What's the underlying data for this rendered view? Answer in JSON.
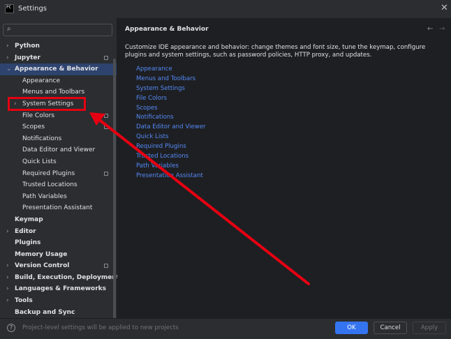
{
  "window": {
    "title": "Settings",
    "app_icon_text": "PC",
    "close_glyph": "✕"
  },
  "search": {
    "value": "",
    "placeholder": ""
  },
  "tree": [
    {
      "label": "Python",
      "level": 0,
      "bold": true,
      "chevron": "›",
      "proj": false
    },
    {
      "label": "Jupyter",
      "level": 0,
      "bold": true,
      "chevron": "›",
      "proj": true
    },
    {
      "label": "Appearance & Behavior",
      "level": 0,
      "bold": true,
      "chevron": "⌄",
      "proj": false,
      "selected": true
    },
    {
      "label": "Appearance",
      "level": 1,
      "bold": false,
      "chevron": "",
      "proj": false
    },
    {
      "label": "Menus and Toolbars",
      "level": 1,
      "bold": false,
      "chevron": "",
      "proj": false
    },
    {
      "label": "System Settings",
      "level": 1,
      "bold": false,
      "chevron": "›",
      "proj": false
    },
    {
      "label": "File Colors",
      "level": 1,
      "bold": false,
      "chevron": "",
      "proj": true
    },
    {
      "label": "Scopes",
      "level": 1,
      "bold": false,
      "chevron": "",
      "proj": true
    },
    {
      "label": "Notifications",
      "level": 1,
      "bold": false,
      "chevron": "",
      "proj": false
    },
    {
      "label": "Data Editor and Viewer",
      "level": 1,
      "bold": false,
      "chevron": "",
      "proj": false
    },
    {
      "label": "Quick Lists",
      "level": 1,
      "bold": false,
      "chevron": "",
      "proj": false
    },
    {
      "label": "Required Plugins",
      "level": 1,
      "bold": false,
      "chevron": "",
      "proj": true
    },
    {
      "label": "Trusted Locations",
      "level": 1,
      "bold": false,
      "chevron": "",
      "proj": false
    },
    {
      "label": "Path Variables",
      "level": 1,
      "bold": false,
      "chevron": "",
      "proj": false
    },
    {
      "label": "Presentation Assistant",
      "level": 1,
      "bold": false,
      "chevron": "",
      "proj": false
    },
    {
      "label": "Keymap",
      "level": 0,
      "bold": true,
      "chevron": "",
      "proj": false
    },
    {
      "label": "Editor",
      "level": 0,
      "bold": true,
      "chevron": "›",
      "proj": false
    },
    {
      "label": "Plugins",
      "level": 0,
      "bold": true,
      "chevron": "",
      "proj": false
    },
    {
      "label": "Memory Usage",
      "level": 0,
      "bold": true,
      "chevron": "",
      "proj": false
    },
    {
      "label": "Version Control",
      "level": 0,
      "bold": true,
      "chevron": "›",
      "proj": true
    },
    {
      "label": "Build, Execution, Deployment",
      "level": 0,
      "bold": true,
      "chevron": "›",
      "proj": false
    },
    {
      "label": "Languages & Frameworks",
      "level": 0,
      "bold": true,
      "chevron": "›",
      "proj": false
    },
    {
      "label": "Tools",
      "level": 0,
      "bold": true,
      "chevron": "›",
      "proj": false
    },
    {
      "label": "Backup and Sync",
      "level": 0,
      "bold": true,
      "chevron": "",
      "proj": false
    }
  ],
  "content": {
    "title": "Appearance & Behavior",
    "description": "Customize IDE appearance and behavior: change themes and font size, tune the keymap, configure plugins and system settings, such as password policies, HTTP proxy, and updates.",
    "nav_back": "←",
    "nav_forward": "→",
    "links": [
      "Appearance",
      "Menus and Toolbars",
      "System Settings",
      "File Colors",
      "Scopes",
      "Notifications",
      "Data Editor and Viewer",
      "Quick Lists",
      "Required Plugins",
      "Trusted Locations",
      "Path Variables",
      "Presentation Assistant"
    ]
  },
  "footer": {
    "help_glyph": "?",
    "hint": "Project-level settings will be applied to new projects",
    "ok": "OK",
    "cancel": "Cancel",
    "apply": "Apply"
  },
  "colors": {
    "background": "#2b2d30",
    "content_background": "#1e1f22",
    "selection": "#2e436e",
    "link": "#548af7",
    "primary_button": "#3574f0",
    "annotation_red": "#e60012"
  }
}
